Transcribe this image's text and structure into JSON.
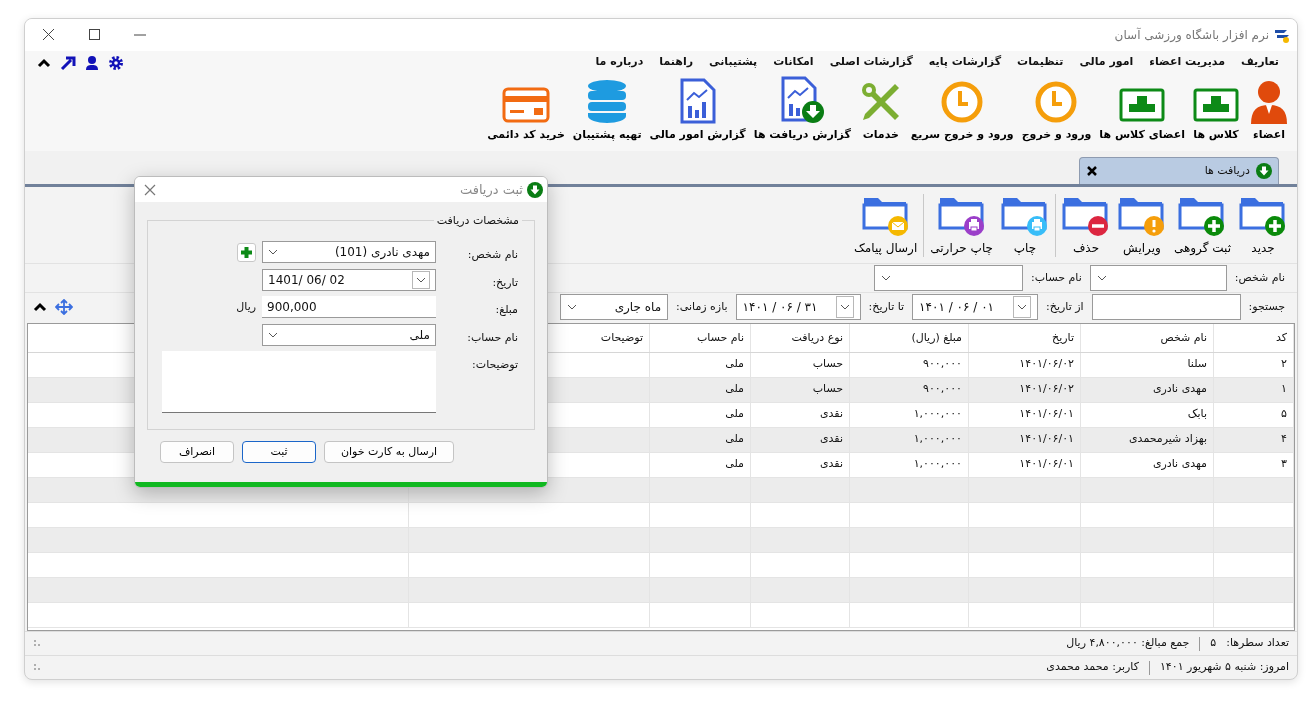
{
  "window": {
    "title": "نرم افزار باشگاه ورزشی آسان"
  },
  "menu": [
    "تعاریف",
    "مدیریت اعضاء",
    "امور مالی",
    "تنظیمات",
    "گزارشات پایه",
    "گزارشات اصلی",
    "امکانات",
    "پشتیبانی",
    "راهنما",
    "درباره ما"
  ],
  "ribbon": [
    {
      "label": "اعضاء",
      "kind": "person"
    },
    {
      "label": "کلاس ها",
      "kind": "board"
    },
    {
      "label": "اعضای کلاس ها",
      "kind": "board"
    },
    {
      "label": "ورود و خروج",
      "kind": "clock"
    },
    {
      "label": "ورود و خروج سریع",
      "kind": "clock"
    },
    {
      "label": "خدمات",
      "kind": "tools"
    },
    {
      "label": "گزارش دریافت ها",
      "kind": "report_download"
    },
    {
      "label": "گزارش امور مالی",
      "kind": "report"
    },
    {
      "label": "تهیه پشتیبان",
      "kind": "database"
    },
    {
      "label": "خرید کد دائمی",
      "kind": "card"
    }
  ],
  "tabs": [
    {
      "label": "دریافت ها",
      "selected": true
    }
  ],
  "toolbar": [
    [
      {
        "label": "جدید",
        "kind": "plus",
        "color": "#0a8a0a"
      },
      {
        "label": "ثبت گروهی",
        "kind": "plus",
        "color": "#0a8a0a"
      },
      {
        "label": "ویرایش",
        "kind": "exclaim",
        "color": "#f59e0b"
      },
      {
        "label": "حذف",
        "kind": "minus",
        "color": "#dc2640"
      }
    ],
    [
      {
        "label": "چاپ",
        "kind": "printer",
        "color": "#38bdf8"
      },
      {
        "label": "چاپ حرارتی",
        "kind": "printer",
        "color": "#9b3fc9"
      }
    ],
    [
      {
        "label": "ارسال پیامک",
        "kind": "envelope",
        "color": "#f5b800"
      }
    ]
  ],
  "filter_rows": [
    [
      {
        "label": "نام شخص:",
        "kind": "combo"
      },
      {
        "label": "نام حساب:",
        "kind": "combo"
      }
    ],
    [
      {
        "label": "جستجو:",
        "kind": "text"
      },
      {
        "label": "از تاریخ:",
        "kind": "date",
        "value": "۱۴۰۱ / ۰۶ / ۰۱"
      },
      {
        "label": "تا تاریخ:",
        "kind": "date",
        "value": "۱۴۰۱ / ۰۶ / ۳۱"
      },
      {
        "label": "بازه زمانی:",
        "kind": "combo",
        "value": "ماه جاری"
      }
    ]
  ],
  "table": {
    "columns": [
      "کد",
      "نام شخص",
      "تاریخ",
      "مبلغ (ریال)",
      "نوع دریافت",
      "نام حساب",
      "توضیحات"
    ],
    "rows": [
      [
        "۲",
        "سلنا",
        "۱۴۰۱/۰۶/۰۲",
        "۹۰۰,۰۰۰",
        "حساب",
        "ملی"
      ],
      [
        "۱",
        "مهدی نادری",
        "۱۴۰۱/۰۶/۰۲",
        "۹۰۰,۰۰۰",
        "حساب",
        "ملی"
      ],
      [
        "۵",
        "بابک",
        "۱۴۰۱/۰۶/۰۱",
        "۱,۰۰۰,۰۰۰",
        "نقدی",
        "ملی"
      ],
      [
        "۴",
        "بهزاد شیرمحمدی",
        "۱۴۰۱/۰۶/۰۱",
        "۱,۰۰۰,۰۰۰",
        "نقدی",
        "ملی"
      ],
      [
        "۳",
        "مهدی نادری",
        "۱۴۰۱/۰۶/۰۱",
        "۱,۰۰۰,۰۰۰",
        "نقدی",
        "ملی"
      ]
    ]
  },
  "status_bar": {
    "row_count_label": "تعداد سطرها:",
    "row_count": "۵",
    "total": "جمع مبالغ: ۴,۸۰۰,۰۰۰ ریال",
    "today": "امروز: شنبه ۵ شهریور ۱۴۰۱",
    "user": "کاربر: محمد محمدی"
  },
  "dialog": {
    "title": "ثبت دریافت",
    "group_title": "مشخصات دریافت",
    "fields": [
      {
        "label": "نام شخص:",
        "kind": "combo",
        "value": "مهدی نادری (101)",
        "add_button": true
      },
      {
        "label": "تاریخ:",
        "kind": "date",
        "value": "1401/ 06/ 02"
      },
      {
        "label": "مبلغ:",
        "kind": "money",
        "value": "900,000",
        "unit": "ریال"
      },
      {
        "label": "نام حساب:",
        "kind": "combo",
        "value": "ملی"
      },
      {
        "label": "توضیحات:",
        "kind": "textarea"
      }
    ],
    "buttons": [
      {
        "label": "ارسال به کارت خوان",
        "focused": false
      },
      {
        "label": "ثبت",
        "focused": true
      },
      {
        "label": "انصراف",
        "focused": false
      }
    ]
  }
}
